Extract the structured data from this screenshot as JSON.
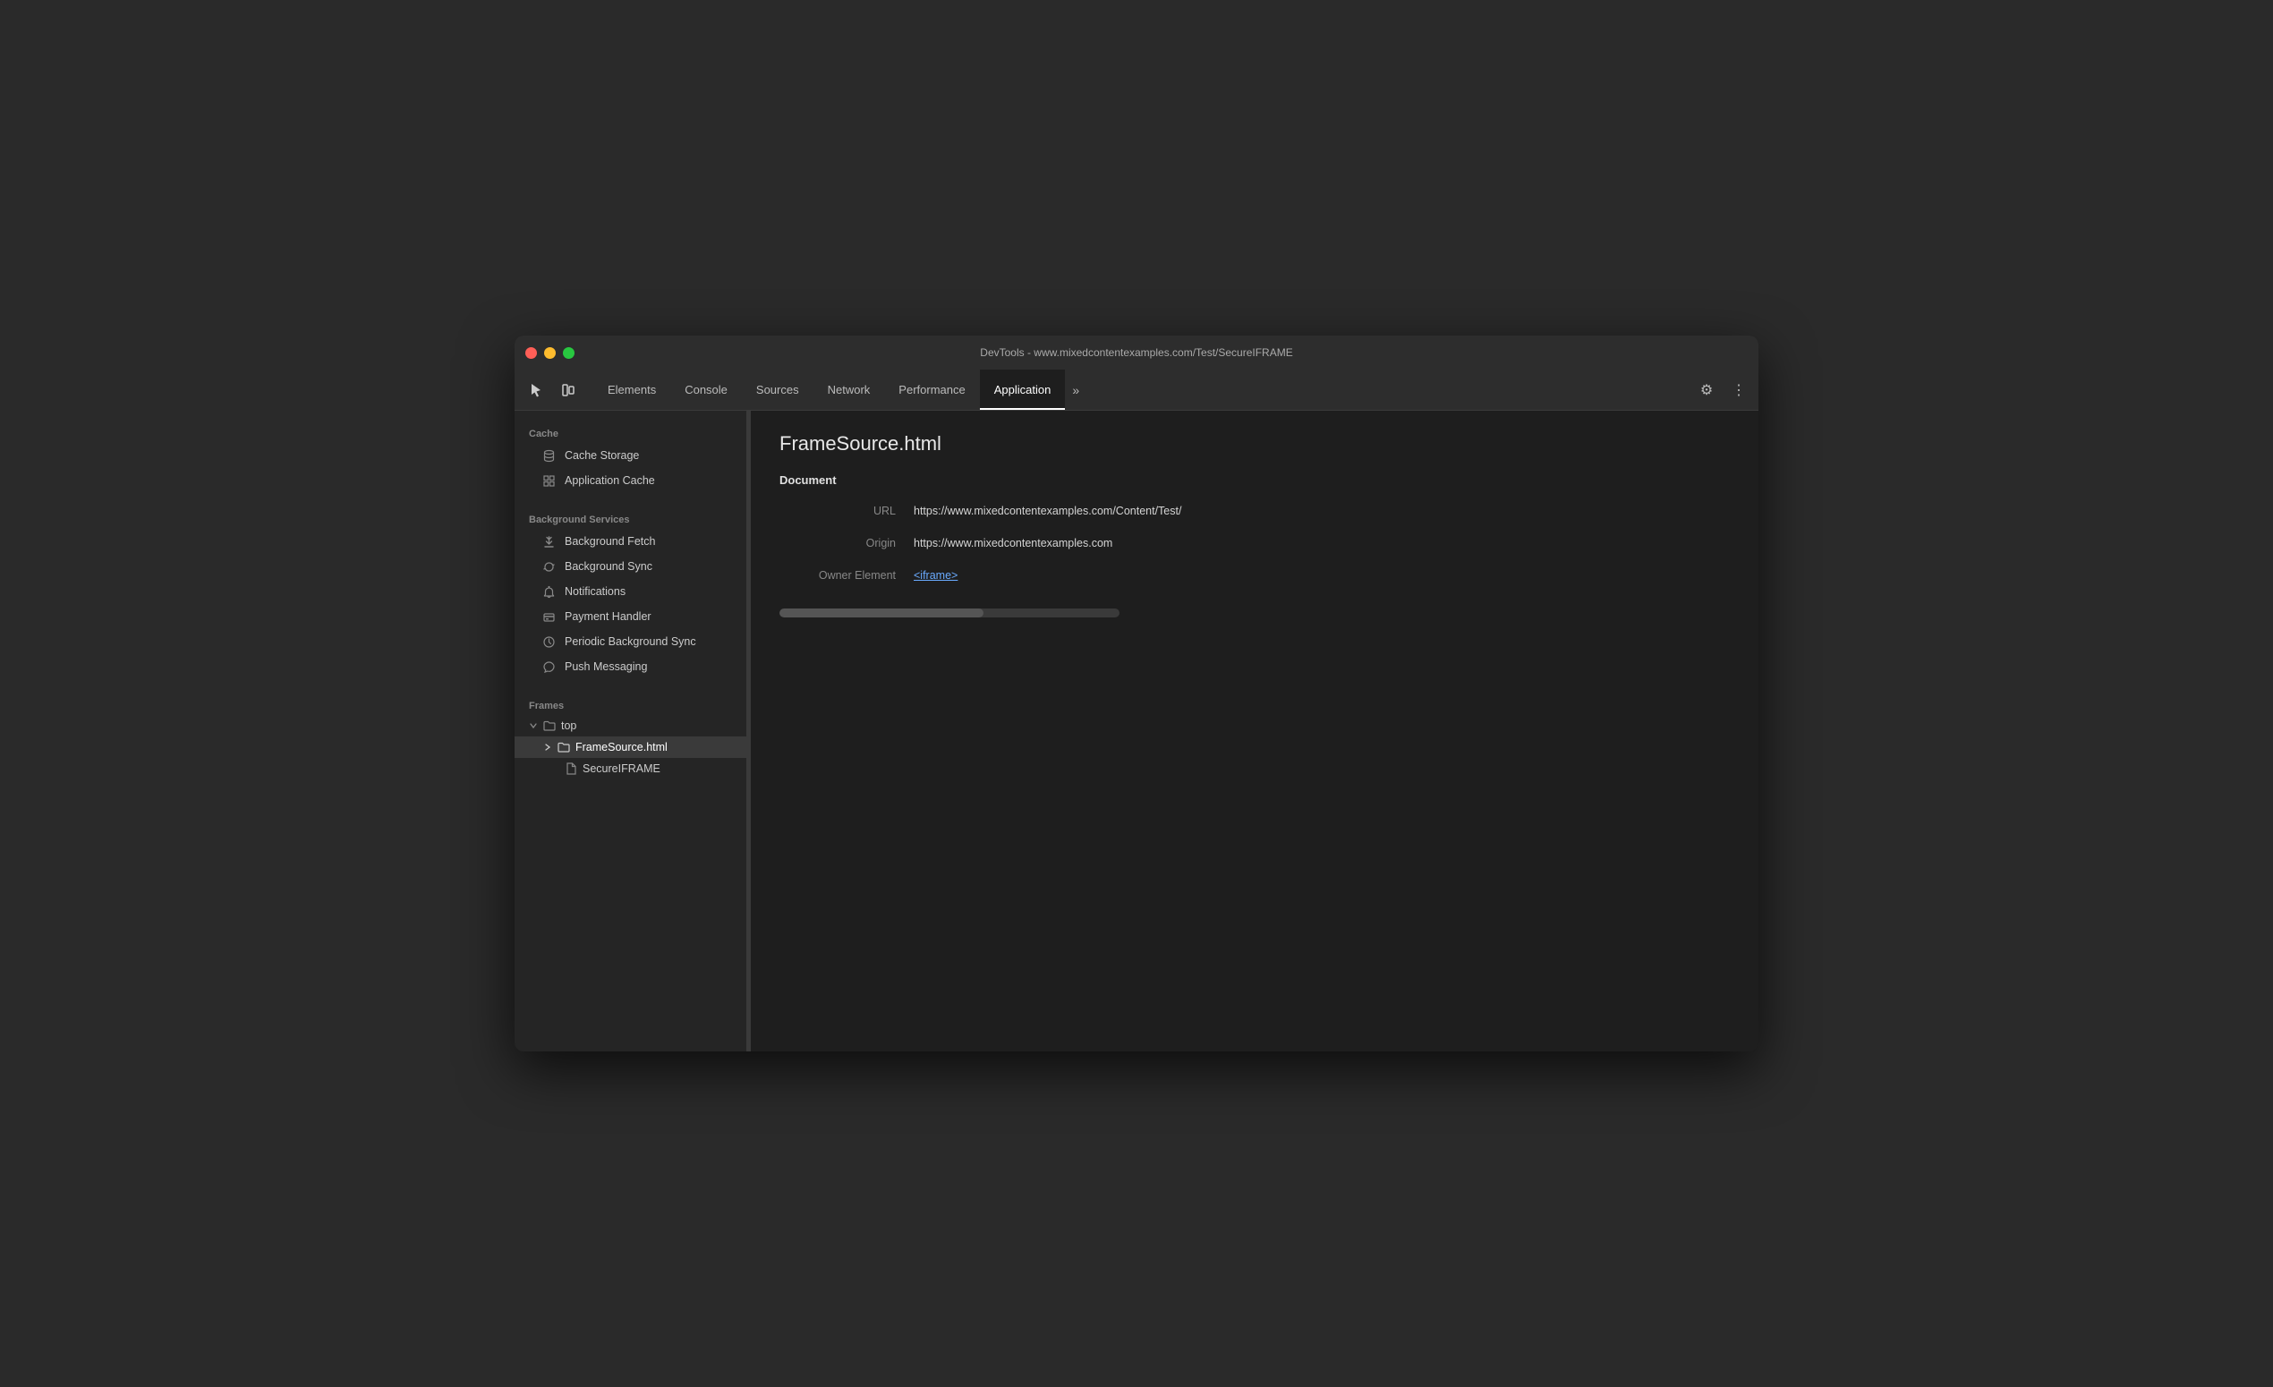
{
  "window": {
    "title": "DevTools - www.mixedcontentexamples.com/Test/SecureIFRAME"
  },
  "toolbar": {
    "tabs": [
      {
        "id": "elements",
        "label": "Elements",
        "active": false
      },
      {
        "id": "console",
        "label": "Console",
        "active": false
      },
      {
        "id": "sources",
        "label": "Sources",
        "active": false
      },
      {
        "id": "network",
        "label": "Network",
        "active": false
      },
      {
        "id": "performance",
        "label": "Performance",
        "active": false
      },
      {
        "id": "application",
        "label": "Application",
        "active": true
      }
    ],
    "more_label": "»",
    "settings_icon": "⚙",
    "menu_icon": "⋮"
  },
  "sidebar": {
    "cache_section": {
      "label": "Cache",
      "items": [
        {
          "id": "cache-storage",
          "label": "Cache Storage"
        },
        {
          "id": "application-cache",
          "label": "Application Cache"
        }
      ]
    },
    "bg_services_section": {
      "label": "Background Services",
      "items": [
        {
          "id": "background-fetch",
          "label": "Background Fetch"
        },
        {
          "id": "background-sync",
          "label": "Background Sync"
        },
        {
          "id": "notifications",
          "label": "Notifications"
        },
        {
          "id": "payment-handler",
          "label": "Payment Handler"
        },
        {
          "id": "periodic-background-sync",
          "label": "Periodic Background Sync"
        },
        {
          "id": "push-messaging",
          "label": "Push Messaging"
        }
      ]
    },
    "frames_section": {
      "label": "Frames",
      "items": [
        {
          "id": "top",
          "label": "top",
          "level": 0,
          "has_arrow": true,
          "expanded": true,
          "icon": "folder"
        },
        {
          "id": "framesource",
          "label": "FrameSource.html",
          "level": 1,
          "has_arrow": true,
          "expanded": false,
          "icon": "folder",
          "active": true
        },
        {
          "id": "secureiframe",
          "label": "SecureIFRAME",
          "level": 2,
          "has_arrow": false,
          "icon": "file"
        }
      ]
    }
  },
  "content": {
    "title": "FrameSource.html",
    "document_heading": "Document",
    "fields": [
      {
        "label": "URL",
        "value": "https://www.mixedcontentexamples.com/Content/Test/",
        "is_link": false
      },
      {
        "label": "Origin",
        "value": "https://www.mixedcontentexamples.com",
        "is_link": false
      },
      {
        "label": "Owner Element",
        "value": "<iframe>",
        "is_link": true
      }
    ]
  }
}
